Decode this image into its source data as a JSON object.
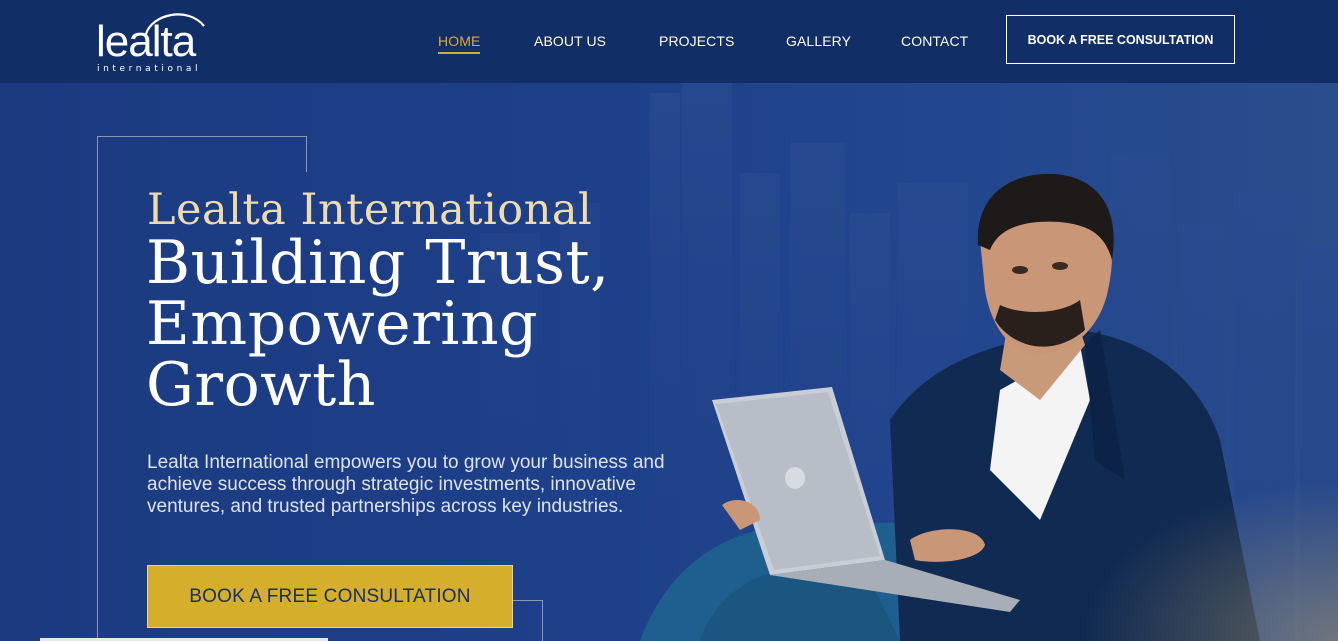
{
  "header": {
    "logo": {
      "word": "lealta",
      "sub": "international"
    },
    "nav": [
      {
        "label": "HOME",
        "active": true
      },
      {
        "label": "ABOUT US",
        "active": false
      },
      {
        "label": "PROJECTS",
        "active": false
      },
      {
        "label": "GALLERY",
        "active": false
      },
      {
        "label": "CONTACT",
        "active": false
      }
    ],
    "cta_label": "BOOK A FREE CONSULTATION"
  },
  "hero": {
    "eyebrow": "Lealta International",
    "headline_lines": [
      "Building Trust,",
      "Empowering",
      "Growth"
    ],
    "lead": "Lealta International empowers you to grow your business and achieve success through strategic investments, innovative ventures, and trusted partnerships across key industries.",
    "cta_label": "BOOK A FREE CONSULTATION"
  },
  "colors": {
    "header_bg": "#122e66",
    "hero_bg": "#1d3d82",
    "accent_gold": "#d5ae2c",
    "eyebrow": "#efdcae"
  },
  "icons": [
    "lealta-logo"
  ]
}
